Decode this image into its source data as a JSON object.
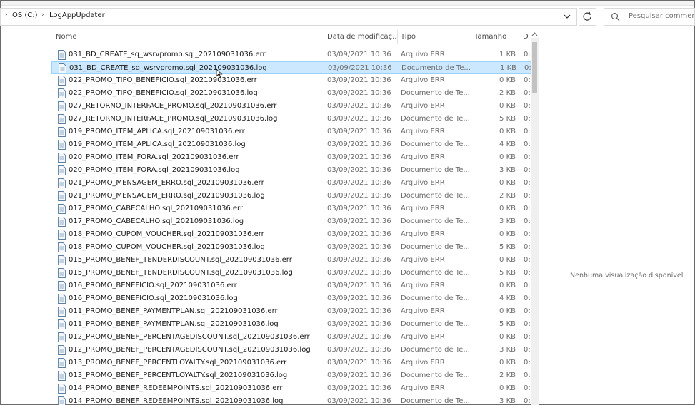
{
  "breadcrumb": {
    "drive": "OS (C:)",
    "folder": "LogAppUpdater"
  },
  "search": {
    "placeholder": "Pesquisar commerce"
  },
  "columns": {
    "name": "Nome",
    "date": "Data de modificaç...",
    "type": "Tipo",
    "size": "Tamanho",
    "d": "D"
  },
  "preview": {
    "message": "Nenhuma visualização disponível."
  },
  "files": [
    {
      "name": "031_BD_CREATE_sq_wsrvpromo.sql_202109031036.err",
      "date": "03/09/2021 10:36",
      "type": "Arquivo ERR",
      "size": "1 KB",
      "d": "0:"
    },
    {
      "name": "031_BD_CREATE_sq_wsrvpromo.sql_202109031036.log",
      "date": "03/09/2021 10:36",
      "type": "Documento de Te...",
      "size": "1 KB",
      "d": "0:"
    },
    {
      "name": "022_PROMO_TIPO_BENEFICIO.sql_202109031036.err",
      "date": "03/09/2021 10:36",
      "type": "Arquivo ERR",
      "size": "0 KB",
      "d": "0:"
    },
    {
      "name": "022_PROMO_TIPO_BENEFICIO.sql_202109031036.log",
      "date": "03/09/2021 10:36",
      "type": "Documento de Te...",
      "size": "2 KB",
      "d": "0:"
    },
    {
      "name": "027_RETORNO_INTERFACE_PROMO.sql_202109031036.err",
      "date": "03/09/2021 10:36",
      "type": "Arquivo ERR",
      "size": "0 KB",
      "d": "0:"
    },
    {
      "name": "027_RETORNO_INTERFACE_PROMO.sql_202109031036.log",
      "date": "03/09/2021 10:36",
      "type": "Documento de Te...",
      "size": "5 KB",
      "d": "0:"
    },
    {
      "name": "019_PROMO_ITEM_APLICA.sql_202109031036.err",
      "date": "03/09/2021 10:36",
      "type": "Arquivo ERR",
      "size": "0 KB",
      "d": "0:"
    },
    {
      "name": "019_PROMO_ITEM_APLICA.sql_202109031036.log",
      "date": "03/09/2021 10:36",
      "type": "Documento de Te...",
      "size": "4 KB",
      "d": "0:"
    },
    {
      "name": "020_PROMO_ITEM_FORA.sql_202109031036.err",
      "date": "03/09/2021 10:36",
      "type": "Arquivo ERR",
      "size": "0 KB",
      "d": "0:"
    },
    {
      "name": "020_PROMO_ITEM_FORA.sql_202109031036.log",
      "date": "03/09/2021 10:36",
      "type": "Documento de Te...",
      "size": "3 KB",
      "d": "0:"
    },
    {
      "name": "021_PROMO_MENSAGEM_ERRO.sql_202109031036.err",
      "date": "03/09/2021 10:36",
      "type": "Arquivo ERR",
      "size": "0 KB",
      "d": "0:"
    },
    {
      "name": "021_PROMO_MENSAGEM_ERRO.sql_202109031036.log",
      "date": "03/09/2021 10:36",
      "type": "Documento de Te...",
      "size": "2 KB",
      "d": "0:"
    },
    {
      "name": "017_PROMO_CABECALHO.sql_202109031036.err",
      "date": "03/09/2021 10:36",
      "type": "Arquivo ERR",
      "size": "0 KB",
      "d": "0:"
    },
    {
      "name": "017_PROMO_CABECALHO.sql_202109031036.log",
      "date": "03/09/2021 10:36",
      "type": "Documento de Te...",
      "size": "3 KB",
      "d": "0:"
    },
    {
      "name": "018_PROMO_CUPOM_VOUCHER.sql_202109031036.err",
      "date": "03/09/2021 10:36",
      "type": "Arquivo ERR",
      "size": "0 KB",
      "d": "0:"
    },
    {
      "name": "018_PROMO_CUPOM_VOUCHER.sql_202109031036.log",
      "date": "03/09/2021 10:36",
      "type": "Documento de Te...",
      "size": "5 KB",
      "d": "0:"
    },
    {
      "name": "015_PROMO_BENEF_TENDERDISCOUNT.sql_202109031036.err",
      "date": "03/09/2021 10:36",
      "type": "Arquivo ERR",
      "size": "0 KB",
      "d": "0:"
    },
    {
      "name": "015_PROMO_BENEF_TENDERDISCOUNT.sql_202109031036.log",
      "date": "03/09/2021 10:36",
      "type": "Documento de Te...",
      "size": "5 KB",
      "d": "0:"
    },
    {
      "name": "016_PROMO_BENEFICIO.sql_202109031036.err",
      "date": "03/09/2021 10:36",
      "type": "Arquivo ERR",
      "size": "0 KB",
      "d": "0:"
    },
    {
      "name": "016_PROMO_BENEFICIO.sql_202109031036.log",
      "date": "03/09/2021 10:36",
      "type": "Documento de Te...",
      "size": "4 KB",
      "d": "0:"
    },
    {
      "name": "011_PROMO_BENEF_PAYMENTPLAN.sql_202109031036.err",
      "date": "03/09/2021 10:36",
      "type": "Arquivo ERR",
      "size": "0 KB",
      "d": "0:"
    },
    {
      "name": "011_PROMO_BENEF_PAYMENTPLAN.sql_202109031036.log",
      "date": "03/09/2021 10:36",
      "type": "Documento de Te...",
      "size": "5 KB",
      "d": "0:"
    },
    {
      "name": "012_PROMO_BENEF_PERCENTAGEDISCOUNT.sql_202109031036.err",
      "date": "03/09/2021 10:36",
      "type": "Arquivo ERR",
      "size": "0 KB",
      "d": "0:"
    },
    {
      "name": "012_PROMO_BENEF_PERCENTAGEDISCOUNT.sql_202109031036.log",
      "date": "03/09/2021 10:36",
      "type": "Documento de Te...",
      "size": "3 KB",
      "d": "0:"
    },
    {
      "name": "013_PROMO_BENEF_PERCENTLOYALTY.sql_202109031036.err",
      "date": "03/09/2021 10:36",
      "type": "Arquivo ERR",
      "size": "0 KB",
      "d": "0:"
    },
    {
      "name": "013_PROMO_BENEF_PERCENTLOYALTY.sql_202109031036.log",
      "date": "03/09/2021 10:36",
      "type": "Documento de Te...",
      "size": "2 KB",
      "d": "0:"
    },
    {
      "name": "014_PROMO_BENEF_REDEEMPOINTS.sql_202109031036.err",
      "date": "03/09/2021 10:36",
      "type": "Arquivo ERR",
      "size": "0 KB",
      "d": "0:"
    },
    {
      "name": "014_PROMO_BENEF_REDEEMPOINTS.sql_202109031036.log",
      "date": "03/09/2021 10:36",
      "type": "Documento de Te...",
      "size": "3 KB",
      "d": "0:"
    }
  ],
  "selected_index": 1
}
